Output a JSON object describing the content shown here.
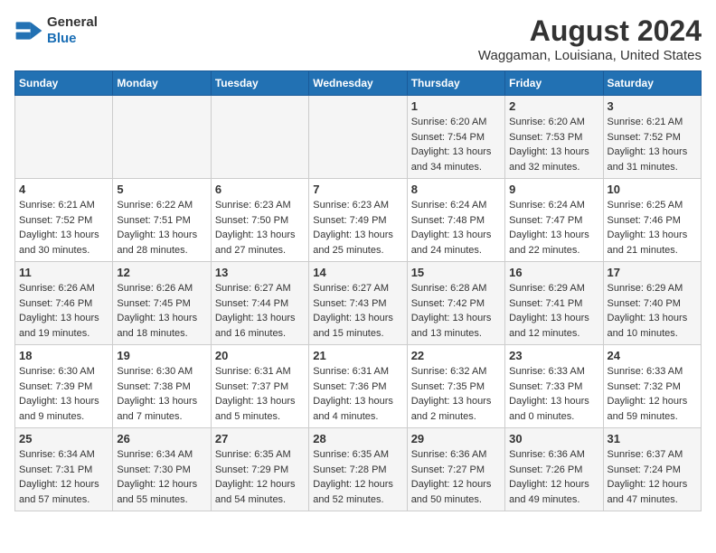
{
  "logo": {
    "line1": "General",
    "line2": "Blue"
  },
  "title": "August 2024",
  "subtitle": "Waggaman, Louisiana, United States",
  "header": {
    "days": [
      "Sunday",
      "Monday",
      "Tuesday",
      "Wednesday",
      "Thursday",
      "Friday",
      "Saturday"
    ]
  },
  "weeks": [
    [
      {
        "day": "",
        "content": ""
      },
      {
        "day": "",
        "content": ""
      },
      {
        "day": "",
        "content": ""
      },
      {
        "day": "",
        "content": ""
      },
      {
        "day": "1",
        "content": "Sunrise: 6:20 AM\nSunset: 7:54 PM\nDaylight: 13 hours\nand 34 minutes."
      },
      {
        "day": "2",
        "content": "Sunrise: 6:20 AM\nSunset: 7:53 PM\nDaylight: 13 hours\nand 32 minutes."
      },
      {
        "day": "3",
        "content": "Sunrise: 6:21 AM\nSunset: 7:52 PM\nDaylight: 13 hours\nand 31 minutes."
      }
    ],
    [
      {
        "day": "4",
        "content": "Sunrise: 6:21 AM\nSunset: 7:52 PM\nDaylight: 13 hours\nand 30 minutes."
      },
      {
        "day": "5",
        "content": "Sunrise: 6:22 AM\nSunset: 7:51 PM\nDaylight: 13 hours\nand 28 minutes."
      },
      {
        "day": "6",
        "content": "Sunrise: 6:23 AM\nSunset: 7:50 PM\nDaylight: 13 hours\nand 27 minutes."
      },
      {
        "day": "7",
        "content": "Sunrise: 6:23 AM\nSunset: 7:49 PM\nDaylight: 13 hours\nand 25 minutes."
      },
      {
        "day": "8",
        "content": "Sunrise: 6:24 AM\nSunset: 7:48 PM\nDaylight: 13 hours\nand 24 minutes."
      },
      {
        "day": "9",
        "content": "Sunrise: 6:24 AM\nSunset: 7:47 PM\nDaylight: 13 hours\nand 22 minutes."
      },
      {
        "day": "10",
        "content": "Sunrise: 6:25 AM\nSunset: 7:46 PM\nDaylight: 13 hours\nand 21 minutes."
      }
    ],
    [
      {
        "day": "11",
        "content": "Sunrise: 6:26 AM\nSunset: 7:46 PM\nDaylight: 13 hours\nand 19 minutes."
      },
      {
        "day": "12",
        "content": "Sunrise: 6:26 AM\nSunset: 7:45 PM\nDaylight: 13 hours\nand 18 minutes."
      },
      {
        "day": "13",
        "content": "Sunrise: 6:27 AM\nSunset: 7:44 PM\nDaylight: 13 hours\nand 16 minutes."
      },
      {
        "day": "14",
        "content": "Sunrise: 6:27 AM\nSunset: 7:43 PM\nDaylight: 13 hours\nand 15 minutes."
      },
      {
        "day": "15",
        "content": "Sunrise: 6:28 AM\nSunset: 7:42 PM\nDaylight: 13 hours\nand 13 minutes."
      },
      {
        "day": "16",
        "content": "Sunrise: 6:29 AM\nSunset: 7:41 PM\nDaylight: 13 hours\nand 12 minutes."
      },
      {
        "day": "17",
        "content": "Sunrise: 6:29 AM\nSunset: 7:40 PM\nDaylight: 13 hours\nand 10 minutes."
      }
    ],
    [
      {
        "day": "18",
        "content": "Sunrise: 6:30 AM\nSunset: 7:39 PM\nDaylight: 13 hours\nand 9 minutes."
      },
      {
        "day": "19",
        "content": "Sunrise: 6:30 AM\nSunset: 7:38 PM\nDaylight: 13 hours\nand 7 minutes."
      },
      {
        "day": "20",
        "content": "Sunrise: 6:31 AM\nSunset: 7:37 PM\nDaylight: 13 hours\nand 5 minutes."
      },
      {
        "day": "21",
        "content": "Sunrise: 6:31 AM\nSunset: 7:36 PM\nDaylight: 13 hours\nand 4 minutes."
      },
      {
        "day": "22",
        "content": "Sunrise: 6:32 AM\nSunset: 7:35 PM\nDaylight: 13 hours\nand 2 minutes."
      },
      {
        "day": "23",
        "content": "Sunrise: 6:33 AM\nSunset: 7:33 PM\nDaylight: 13 hours\nand 0 minutes."
      },
      {
        "day": "24",
        "content": "Sunrise: 6:33 AM\nSunset: 7:32 PM\nDaylight: 12 hours\nand 59 minutes."
      }
    ],
    [
      {
        "day": "25",
        "content": "Sunrise: 6:34 AM\nSunset: 7:31 PM\nDaylight: 12 hours\nand 57 minutes."
      },
      {
        "day": "26",
        "content": "Sunrise: 6:34 AM\nSunset: 7:30 PM\nDaylight: 12 hours\nand 55 minutes."
      },
      {
        "day": "27",
        "content": "Sunrise: 6:35 AM\nSunset: 7:29 PM\nDaylight: 12 hours\nand 54 minutes."
      },
      {
        "day": "28",
        "content": "Sunrise: 6:35 AM\nSunset: 7:28 PM\nDaylight: 12 hours\nand 52 minutes."
      },
      {
        "day": "29",
        "content": "Sunrise: 6:36 AM\nSunset: 7:27 PM\nDaylight: 12 hours\nand 50 minutes."
      },
      {
        "day": "30",
        "content": "Sunrise: 6:36 AM\nSunset: 7:26 PM\nDaylight: 12 hours\nand 49 minutes."
      },
      {
        "day": "31",
        "content": "Sunrise: 6:37 AM\nSunset: 7:24 PM\nDaylight: 12 hours\nand 47 minutes."
      }
    ]
  ]
}
